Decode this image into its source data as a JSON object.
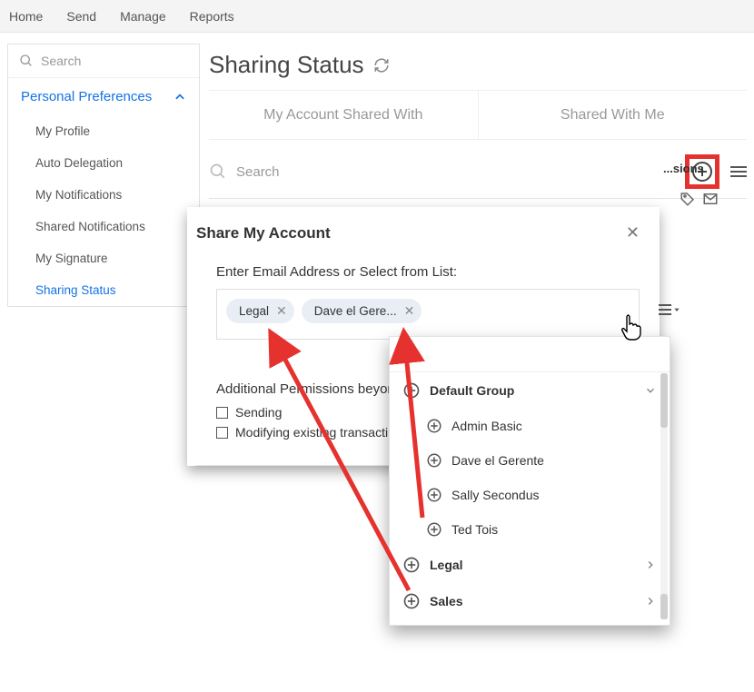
{
  "topnav": {
    "items": [
      "Home",
      "Send",
      "Manage",
      "Reports"
    ]
  },
  "sidebar": {
    "search_placeholder": "Search",
    "section": "Personal Preferences",
    "items": [
      {
        "label": "My Profile"
      },
      {
        "label": "Auto Delegation"
      },
      {
        "label": "My Notifications"
      },
      {
        "label": "Shared Notifications"
      },
      {
        "label": "My Signature"
      },
      {
        "label": "Sharing Status",
        "active": true
      }
    ]
  },
  "page": {
    "title": "Sharing Status",
    "tabs": [
      "My Account Shared With",
      "Shared With Me"
    ],
    "search_placeholder": "Search",
    "peek_column": "...sions"
  },
  "modal": {
    "title": "Share My Account",
    "field_label": "Enter Email Address or Select from List:",
    "chips": [
      "Legal",
      "Dave el Gere..."
    ],
    "permissions_label": "Additional Permissions beyon",
    "permissions": [
      "Sending",
      "Modifying existing transacti"
    ]
  },
  "dropdown": {
    "groups": [
      {
        "name": "Default Group",
        "expanded": true,
        "members": [
          "Admin Basic",
          "Dave el Gerente",
          "Sally Secondus",
          "Ted Tois"
        ]
      },
      {
        "name": "Legal",
        "expanded": false
      },
      {
        "name": "Sales",
        "expanded": false
      }
    ]
  },
  "icons": {
    "search": "search-icon",
    "refresh": "refresh-icon",
    "plus": "plus-circle-icon",
    "burger": "menu-icon",
    "chevron_up": "chevron-up-icon",
    "chevron_down": "chevron-down-icon",
    "chevron_right": "chevron-right-icon",
    "close": "close-icon",
    "envelope": "envelope-icon",
    "tag": "tag-icon"
  }
}
